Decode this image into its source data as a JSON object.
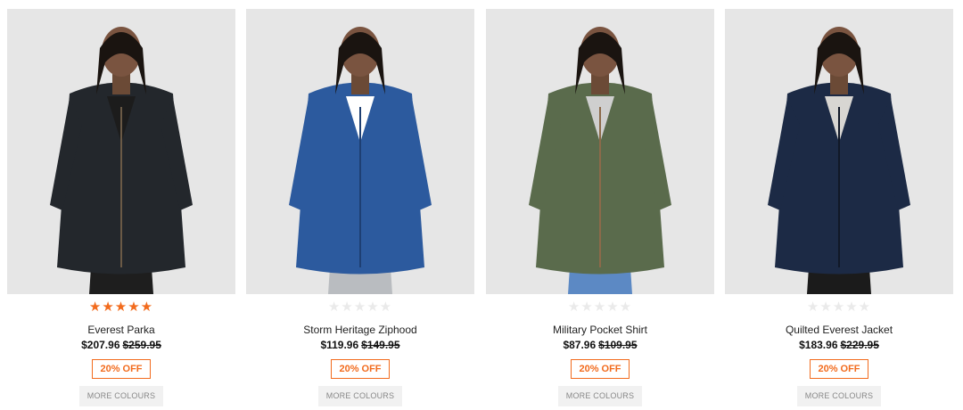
{
  "products": [
    {
      "name": "Everest Parka",
      "sale_price": "$207.96",
      "original_price": "$259.95",
      "discount": "20% OFF",
      "more_colours": "MORE COLOURS",
      "rating": 5,
      "image": {
        "jacket_color": "#23272c",
        "accent": "#6b5a46",
        "pants": "#1e1e1e",
        "shirt": "#1c1c1c"
      }
    },
    {
      "name": "Storm Heritage Ziphood",
      "sale_price": "$119.96",
      "original_price": "$149.95",
      "discount": "20% OFF",
      "more_colours": "MORE COLOURS",
      "rating": 0,
      "image": {
        "jacket_color": "#2c5a9e",
        "accent": "#1e3f73",
        "pants": "#b9bcc0",
        "shirt": "#ffffff"
      }
    },
    {
      "name": "Military Pocket Shirt",
      "sale_price": "$87.96",
      "original_price": "$109.95",
      "discount": "20% OFF",
      "more_colours": "MORE COLOURS",
      "rating": 0,
      "image": {
        "jacket_color": "#5a6b4c",
        "accent": "#8c6a4a",
        "pants": "#5c89c4",
        "shirt": "#cfcfcf"
      }
    },
    {
      "name": "Quilted Everest Jacket",
      "sale_price": "$183.96",
      "original_price": "$229.95",
      "discount": "20% OFF",
      "more_colours": "MORE COLOURS",
      "rating": 0,
      "image": {
        "jacket_color": "#1c2a45",
        "accent": "#111827",
        "pants": "#1b1b1b",
        "shirt": "#d8d6d2"
      }
    }
  ]
}
